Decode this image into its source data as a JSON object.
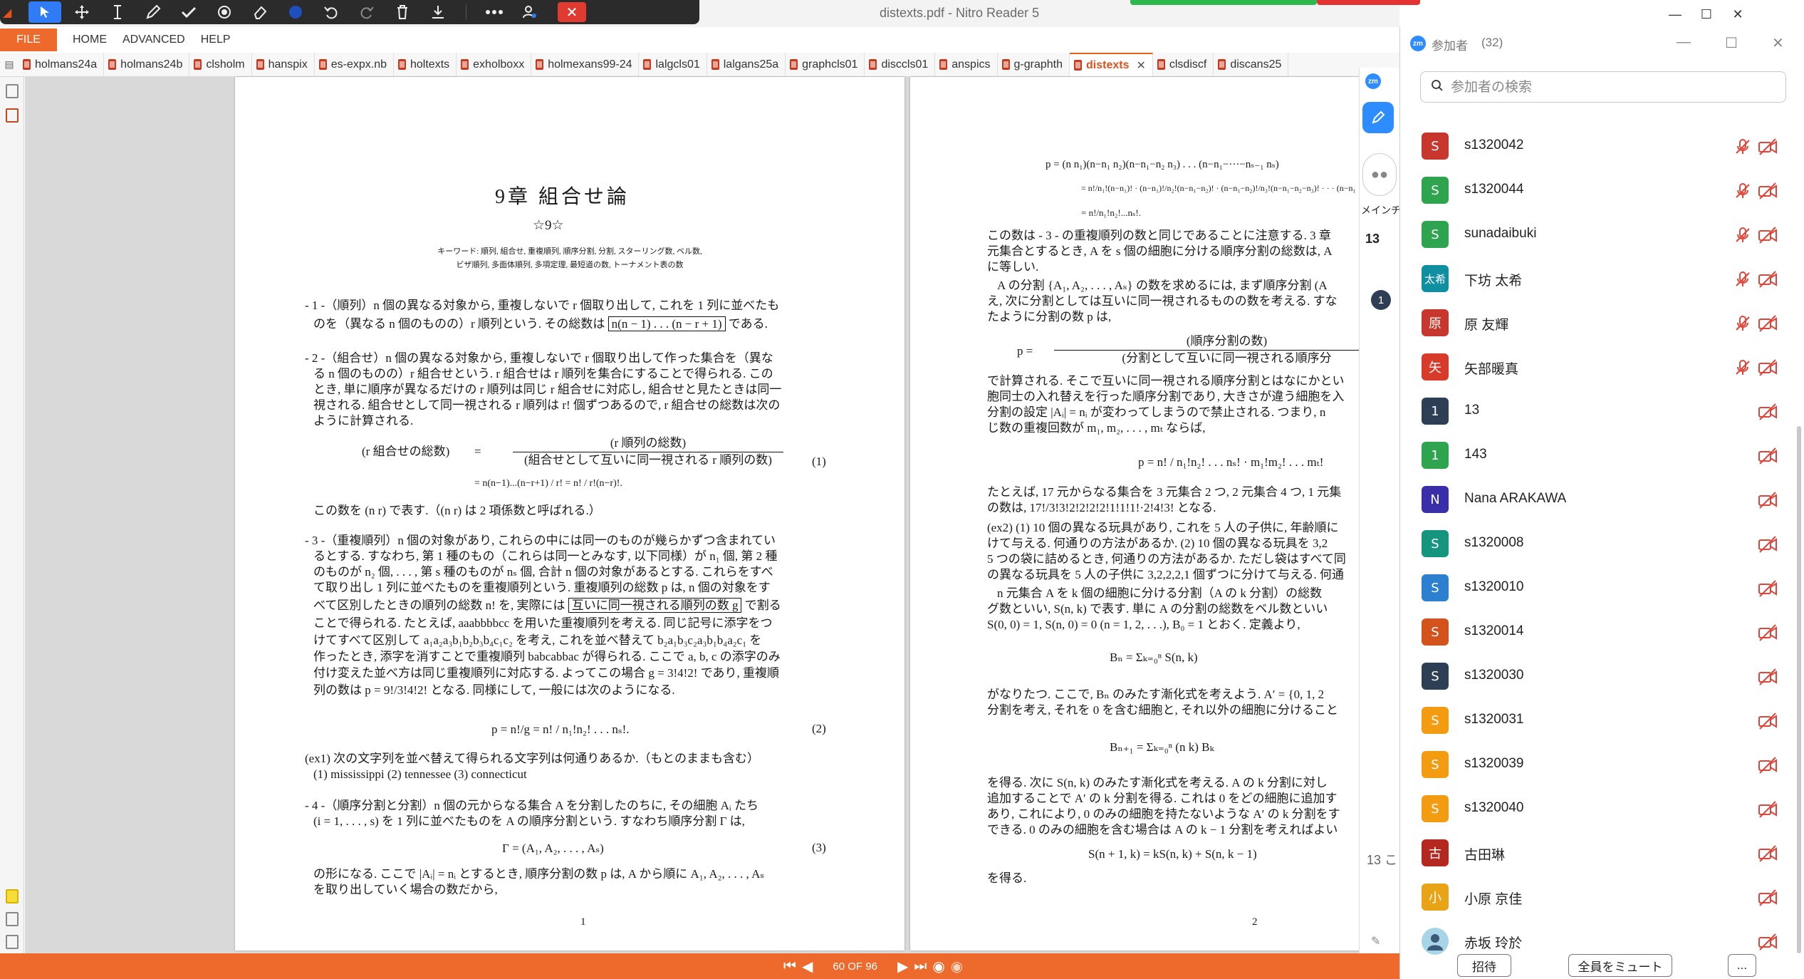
{
  "app": {
    "title": "distexts.pdf - Nitro Reader 5",
    "minimize": "—",
    "maximize": "☐",
    "close": "✕"
  },
  "menu": {
    "file": "FILE",
    "items": [
      "HOME",
      "ADVANCED",
      "HELP"
    ]
  },
  "tabs": [
    {
      "label": "holmans24a"
    },
    {
      "label": "holmans24b"
    },
    {
      "label": "clsholm"
    },
    {
      "label": "hanspix"
    },
    {
      "label": "es-expx.nb"
    },
    {
      "label": "holtexts"
    },
    {
      "label": "exholboxx"
    },
    {
      "label": "holmexans99-24"
    },
    {
      "label": "lalgcls01"
    },
    {
      "label": "lalgans25a"
    },
    {
      "label": "graphcls01"
    },
    {
      "label": "disccls01"
    },
    {
      "label": "anspics"
    },
    {
      "label": "g-graphth"
    },
    {
      "label": "distexts",
      "active": true
    },
    {
      "label": "clsdiscf"
    },
    {
      "label": "discans25"
    }
  ],
  "page1": {
    "title": "9章 組合せ論",
    "star": "☆9☆",
    "keywords1": "キーワード: 順列, 組合せ, 重複順列, 順序分割, 分割, スターリング数, ベル数,",
    "keywords2": "ビザ順列, 多面体順列, 多項定理, 最短道の数, トーナメント表の数",
    "s1a": "- 1 -（順列）n 個の異なる対象から, 重複しないで r 個取り出して, これを 1 列に並べたも",
    "s1b_pre": "のを（異なる n 個のものの）r 順列という. その総数は",
    "s1b_box": "n(n − 1) . . . (n − r + 1)",
    "s1b_post": "である.",
    "s2a": "- 2 -（組合せ）n 個の異なる対象から, 重複しないで r 個取り出して作った集合を（異な",
    "s2b": "る n 個のものの）r 組合せという. r 組合せは r 順列を集合にすることで得られる. この",
    "s2c": "とき, 単に順序が異なるだけの r 順列は同じ r 組合せに対応し, 組合せと見たときは同一",
    "s2d": "視される. 組合せとして同一視される r 順列は r! 個ずつあるので, r 組合せの総数は次の",
    "s2e": "ように計算される.",
    "eq1_lhs": "(r 組合せの総数)",
    "eq1_num": "(r 順列の総数)",
    "eq1_den": "(組合せとして互いに同一視される r 順列の数)",
    "eq1_line2": "= n(n−1)...(n−r+1) / r! = n! / r!(n−r)!.",
    "eq1_no": "(1)",
    "binom_note": "この数を (n r) で表す.（(n r) は 2 項係数と呼ばれる.）",
    "s3a": "- 3 -（重複順列）n 個の対象があり, これらの中には同一のものが幾らかずつ含まれてい",
    "s3b": "るとする. すなわち, 第 1 種のもの（これらは同一とみなす, 以下同様）が n₁ 個, 第 2 種",
    "s3c": "のものが n₂ 個, . . . , 第 s 種のものが nₛ 個, 合計 n 個の対象があるとする. これらをすべ",
    "s3d": "て取り出し 1 列に並べたものを重複順列という. 重複順列の総数 p は, n 個の対象をす",
    "s3e_pre": "べて区別したときの順列の総数 n! を, 実際には",
    "s3e_box": "互いに同一視される順列の数 g",
    "s3e_post": "で割る",
    "s3f": "ことで得られる. たとえば, aaabbbbcc を用いた重複順列を考える. 同じ記号に添字をつ",
    "s3g": "けてすべて区別して a₁a₂a₃b₁b₂b₃b₄c₁c₂ を考え, これを並べ替えて b₂a₁b₃c₂a₃b₁b₄a₂c₁ を",
    "s3h": "作ったとき, 添字を消すことで重複順列 babcabbac が得られる. ここで a, b, c の添字のみ",
    "s3i": "付け変えた並べ方は同じ重複順列に対応する. よってこの場合 g = 3!4!2! であり, 重複順",
    "s3j": "列の数は p = 9!/3!4!2! となる. 同様にして, 一般には次のようになる.",
    "eq2": "p = n!/g = n! / n₁!n₂! . . . nₛ!.",
    "eq2_no": "(2)",
    "ex1a": "(ex1) 次の文字列を並べ替えて得られる文字列は何通りあるか.（もとのままも含む）",
    "ex1b": "(1) mississippi   (2) tennessee   (3) connecticut",
    "s4a": "- 4 -（順序分割と分割）n 個の元からなる集合 A を分割したのちに, その細胞 Aᵢ たち",
    "s4b": "(i = 1, . . . , s) を 1 列に並べたものを A の順序分割という. すなわち順序分割 Γ は,",
    "eq3": "Γ = (A₁, A₂, . . . , Aₛ)",
    "eq3_no": "(3)",
    "s4c": "の形になる. ここで |Aᵢ| = nᵢ とするとき, 順序分割の数 p は, A から順に A₁, A₂, . . . , Aₛ",
    "s4d": "を取り出していく場合の数だから,",
    "page_no": "1"
  },
  "page2": {
    "eqa": "p = (n n₁)(n−n₁ n₂)(n−n₁−n₂ n₃) . . . (n−n₁−···−nₛ₋₁ nₛ)",
    "eqb": "= n!/n₁!(n−n₁)! · (n−n₁)!/n₂!(n−n₁−n₂)! · (n−n₁−n₂)!/n₃!(n−n₁−n₂−n₃)! · · · (n−n₁",
    "eqc": "= n!/n₁!n₂!...nₛ!.",
    "t1": "この数は - 3 - の重複順列の数と同じであることに注意する. 3 章",
    "t2": "元集合とするとき, A を s 個の細胞に分ける順序分割の総数は, A",
    "t3": "に等しい.",
    "t4": "A の分割 {A₁, A₂, . . . , Aₛ} の数を求めるには, まず順序分割 (A",
    "t5": "え, 次に分割としては互いに同一視されるものの数を考える. すな",
    "t6": "たように分割の数 p は,",
    "eqd_lhs": "p =",
    "eqd_num": "(順序分割の数)",
    "eqd_den": "(分割として互いに同一視される順序分",
    "t7": "で計算される. そこで互いに同一視される順序分割とはなにかとい",
    "t8": "胞同士の入れ替えを行った順序分割であり, 大きさが違う細胞を入",
    "t9": "分割の設定 |Aᵢ| = nᵢ が変わってしまうので禁止される. つまり, n",
    "t10": "じ数の重複回数が m₁, m₂, . . . , mₜ ならば,",
    "eqe": "p = n! / n₁!n₂! . . . nₛ! · m₁!m₂! . . . mₜ!",
    "t11": "たとえば, 17 元からなる集合を 3 元集合 2 つ, 2 元集合 4 つ, 1 元集",
    "t12": "の数は, 17!/3!3!2!2!2!2!1!1!1!·2!4!3! となる.",
    "t13": "(ex2) (1) 10 個の異なる玩具があり, これを 5 人の子供に, 年齢順に",
    "t14": "けて与える. 何通りの方法があるか. (2) 10 個の異なる玩具を 3,2",
    "t15": "5 つの袋に詰めるとき, 何通りの方法があるか. ただし袋はすべて同",
    "t16": "の異なる玩具を 5 人の子供に 3,2,2,2,1 個ずつに分けて与える. 何通",
    "t17": "n 元集合 A を k 個の細胞に分ける分割（A の k 分割）の総数",
    "t18": "グ数といい, S(n, k) で表す. 単に A の分割の総数をベル数といい",
    "t19": "S(0, 0) = 1, S(n, 0) = 0 (n = 1, 2, . . .), B₀ = 1 とおく. 定義より,",
    "eqf": "Bₙ = Σₖ₌₀ⁿ S(n, k)",
    "t20": "がなりたつ. ここで, Bₙ のみたす漸化式を考えよう. A′ = {0, 1, 2",
    "t21": "分割を考え, それを 0 を含む細胞と, それ以外の細胞に分けること",
    "eqg": "Bₙ₊₁ = Σₖ₌₀ⁿ (n k) Bₖ",
    "t22": "を得る. 次に S(n, k) のみたす漸化式を考える. A の k 分割に対し",
    "t23": "追加することで A′ の k 分割を得る. これは 0 をどの細胞に追加す",
    "t24": "あり, これにより, 0 のみの細胞を持たないような A′ の k 分割をす",
    "t25": "できる. 0 のみの細胞を含む場合は A の k − 1 分割を考えればよい",
    "eqh": "S(n + 1, k) = kS(n, k) + S(n, k − 1)",
    "t26": "を得る.",
    "page_no": "2"
  },
  "nav": {
    "page_indicator": "60 OF 96"
  },
  "zoom_strip": {
    "label": "メインチ",
    "count": "13",
    "count2": "13 こ",
    "badge": "1"
  },
  "participants": {
    "title": "参加者",
    "count": "(32)",
    "search_placeholder": "参加者の検索",
    "invite": "招待",
    "mute_all": "全員をミュート",
    "more": "...",
    "list": [
      {
        "avatar": "S",
        "name": "s1320042",
        "color": "#c8372d",
        "mic_muted": true
      },
      {
        "avatar": "S",
        "name": "s1320044",
        "color": "#2ea44f",
        "mic_muted": true
      },
      {
        "avatar": "S",
        "name": "sunadaibuki",
        "color": "#2ea44f",
        "mic_muted": true
      },
      {
        "avatar": "太希",
        "name": "下坊 太希",
        "color": "#0f8f9f",
        "mic_muted": true
      },
      {
        "avatar": "原",
        "name": "原 友輝",
        "color": "#c8372d",
        "mic_muted": true
      },
      {
        "avatar": "矢",
        "name": "矢部暖真",
        "color": "#d83b2a",
        "mic_muted": true
      },
      {
        "avatar": "1",
        "name": "13",
        "color": "#2e3f55",
        "mic_muted": false
      },
      {
        "avatar": "1",
        "name": "143",
        "color": "#2ea44f",
        "mic_muted": false
      },
      {
        "avatar": "N",
        "name": "Nana ARAKAWA",
        "color": "#3a2fa8",
        "mic_muted": false
      },
      {
        "avatar": "S",
        "name": "s1320008",
        "color": "#15957e",
        "mic_muted": false
      },
      {
        "avatar": "S",
        "name": "s1320010",
        "color": "#2d7fd0",
        "mic_muted": false
      },
      {
        "avatar": "S",
        "name": "s1320014",
        "color": "#d4521c",
        "mic_muted": false
      },
      {
        "avatar": "S",
        "name": "s1320030",
        "color": "#2e3f55",
        "mic_muted": false
      },
      {
        "avatar": "S",
        "name": "s1320031",
        "color": "#f39c12",
        "mic_muted": false
      },
      {
        "avatar": "S",
        "name": "s1320039",
        "color": "#f39c12",
        "mic_muted": false
      },
      {
        "avatar": "S",
        "name": "s1320040",
        "color": "#f39c12",
        "mic_muted": false
      },
      {
        "avatar": "古",
        "name": "古田琳",
        "color": "#b5281f",
        "mic_muted": false
      },
      {
        "avatar": "小",
        "name": "小原 京佳",
        "color": "#e8a317",
        "mic_muted": false
      },
      {
        "avatar": "",
        "name": "赤坂 玲於",
        "color": "#a8d4e8",
        "mic_muted": false
      }
    ]
  }
}
